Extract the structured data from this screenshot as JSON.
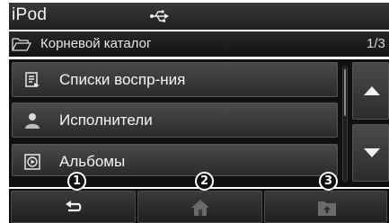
{
  "header": {
    "title": "iPod",
    "usb_icon": "usb-icon"
  },
  "path": {
    "folder_icon": "folder-open-icon",
    "label": "Корневой каталог",
    "page": "1/3"
  },
  "list": {
    "items": [
      {
        "label": "Списки воспр-ния",
        "icon": "playlist-icon"
      },
      {
        "label": "Исполнители",
        "icon": "artist-icon"
      },
      {
        "label": "Альбомы",
        "icon": "album-icon"
      }
    ],
    "scroll_up_icon": "arrow-up-icon",
    "scroll_down_icon": "arrow-down-icon"
  },
  "bottom": {
    "buttons": [
      {
        "icon": "back-icon",
        "callout": "1"
      },
      {
        "icon": "home-icon",
        "callout": "2"
      },
      {
        "icon": "folder-up-icon",
        "callout": "3"
      }
    ]
  },
  "colors": {
    "background": "#101010",
    "button": "#3a3a3a",
    "text": "#f4f4f4",
    "disabled_icon": "#6a6a6a"
  }
}
